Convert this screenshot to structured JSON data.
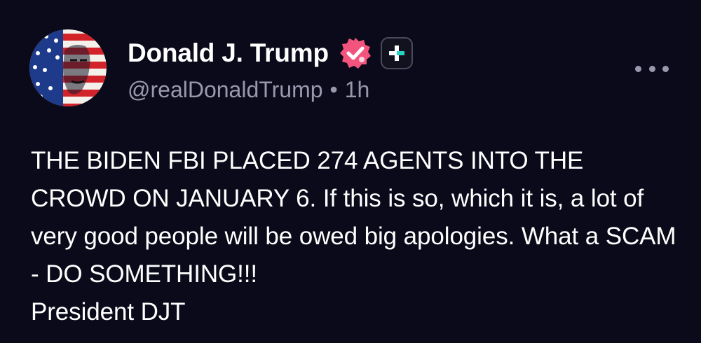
{
  "post": {
    "author": {
      "display_name": "Donald J. Trump",
      "handle": "@realDonaldTrump",
      "timestamp": "1h",
      "separator": "•",
      "avatar_icon": "flag-portrait-avatar",
      "verified_icon": "verified-badge-icon",
      "verified_color": "#f2547d",
      "plus_badge_icon": "plus-badge-icon"
    },
    "more_icon": "more-options-icon",
    "body_text": "THE BIDEN FBI PLACED 274 AGENTS INTO THE CROWD ON JANUARY 6. If this is so, which it is, a lot of very good people will be owed big apologies. What a SCAM - DO SOMETHING!!!",
    "signature": "President DJT"
  },
  "theme": {
    "background": "#0b0a1a",
    "text": "#ffffff",
    "muted_text": "#9a98ad"
  }
}
